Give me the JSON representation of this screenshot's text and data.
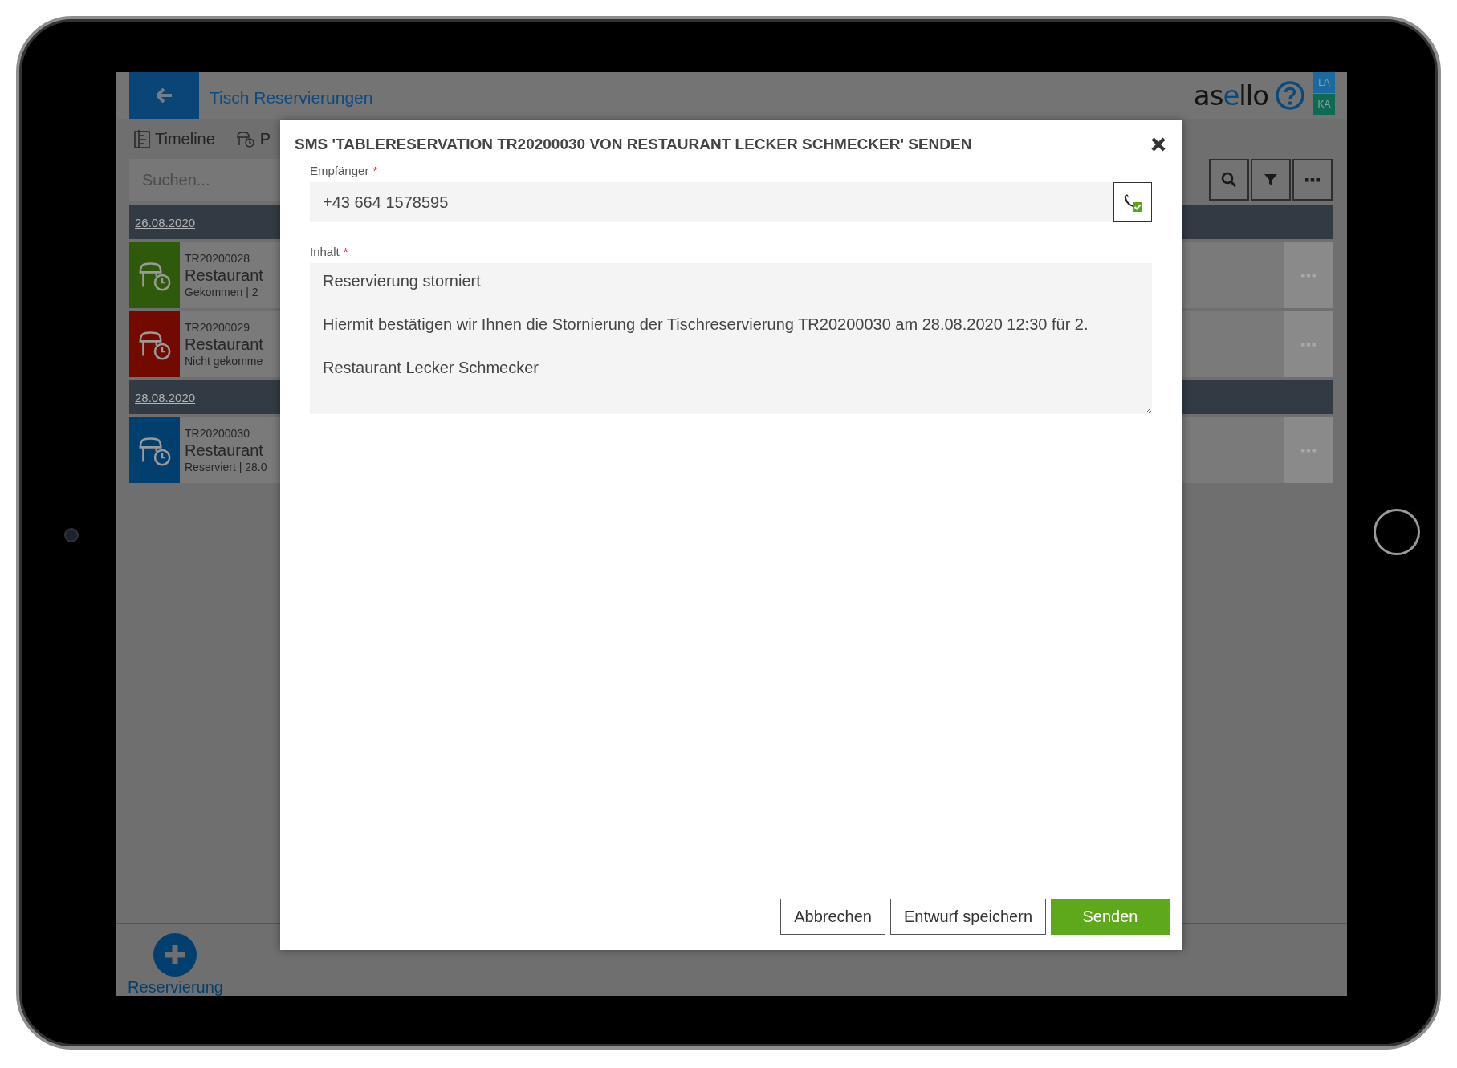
{
  "app": {
    "title": "Tisch Reservierungen",
    "logo_start": "as",
    "logo_accent": "e",
    "logo_end": "llo",
    "user_badges": [
      {
        "text": "LA",
        "color": "#1a6aa0"
      },
      {
        "text": "KA",
        "color": "#0e6a52"
      }
    ]
  },
  "tabs": [
    {
      "label": "Timeline",
      "kind": "timeline"
    },
    {
      "label": "P",
      "kind": "table"
    }
  ],
  "search": {
    "placeholder": "Suchen..."
  },
  "groups": [
    {
      "date": "26.08.2020",
      "reservations": [
        {
          "number": "TR20200028",
          "name": "Restaurant",
          "status": "Gekommen | 2",
          "color": "#2f5a0c"
        },
        {
          "number": "TR20200029",
          "name": "Restaurant",
          "status": "Nicht gekomme",
          "color": "#730a00"
        }
      ]
    },
    {
      "date": "28.08.2020",
      "reservations": [
        {
          "number": "TR20200030",
          "name": "Restaurant",
          "status": "Reserviert | 28.0",
          "color": "#013f6e"
        }
      ]
    }
  ],
  "add_button": {
    "label": "Reservierung"
  },
  "dialog": {
    "title": "SMS 'TABLERESERVATION TR20200030 VON RESTAURANT LECKER SCHMECKER' SENDEN",
    "fields": [
      {
        "kind": "phone",
        "label": "Empfänger",
        "required_mark": "*",
        "value": "+43 664 1578595",
        "verified": true
      },
      {
        "kind": "textarea",
        "label": "Inhalt",
        "required_mark": "*",
        "value": "Reservierung storniert\n\nHiermit bestätigen wir Ihnen die Stornierung der Tischreservierung TR20200030 am 28.08.2020 12:30 für 2.\n\nRestaurant Lecker Schmecker"
      }
    ],
    "buttons": [
      {
        "label": "Abbrechen",
        "kind": "secondary"
      },
      {
        "label": "Entwurf speichern",
        "kind": "secondary"
      },
      {
        "label": "Senden",
        "kind": "primary"
      }
    ]
  }
}
